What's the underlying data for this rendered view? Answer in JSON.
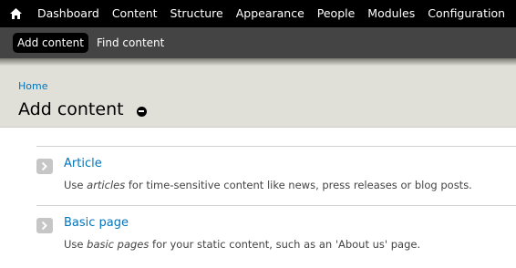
{
  "toolbar": {
    "home_icon": "home-icon",
    "menu": [
      "Dashboard",
      "Content",
      "Structure",
      "Appearance",
      "People",
      "Modules",
      "Configuration"
    ]
  },
  "shortcuts": {
    "items": [
      "Add content",
      "Find content"
    ],
    "active_index": 0
  },
  "header": {
    "breadcrumb": "Home",
    "title": "Add content",
    "shortcut_icon": "remove-shortcut-icon"
  },
  "content_types": [
    {
      "name": "Article",
      "desc_prefix": "Use ",
      "desc_em": "articles",
      "desc_suffix": " for time-sensitive content like news, press releases or blog posts."
    },
    {
      "name": "Basic page",
      "desc_prefix": "Use ",
      "desc_em": "basic pages",
      "desc_suffix": " for your static content, such as an 'About us' page."
    }
  ],
  "colors": {
    "link": "#0074bd",
    "toolbar_bg": "#000000",
    "shortcut_bg": "#444444",
    "header_bg": "#e0e0d8"
  }
}
